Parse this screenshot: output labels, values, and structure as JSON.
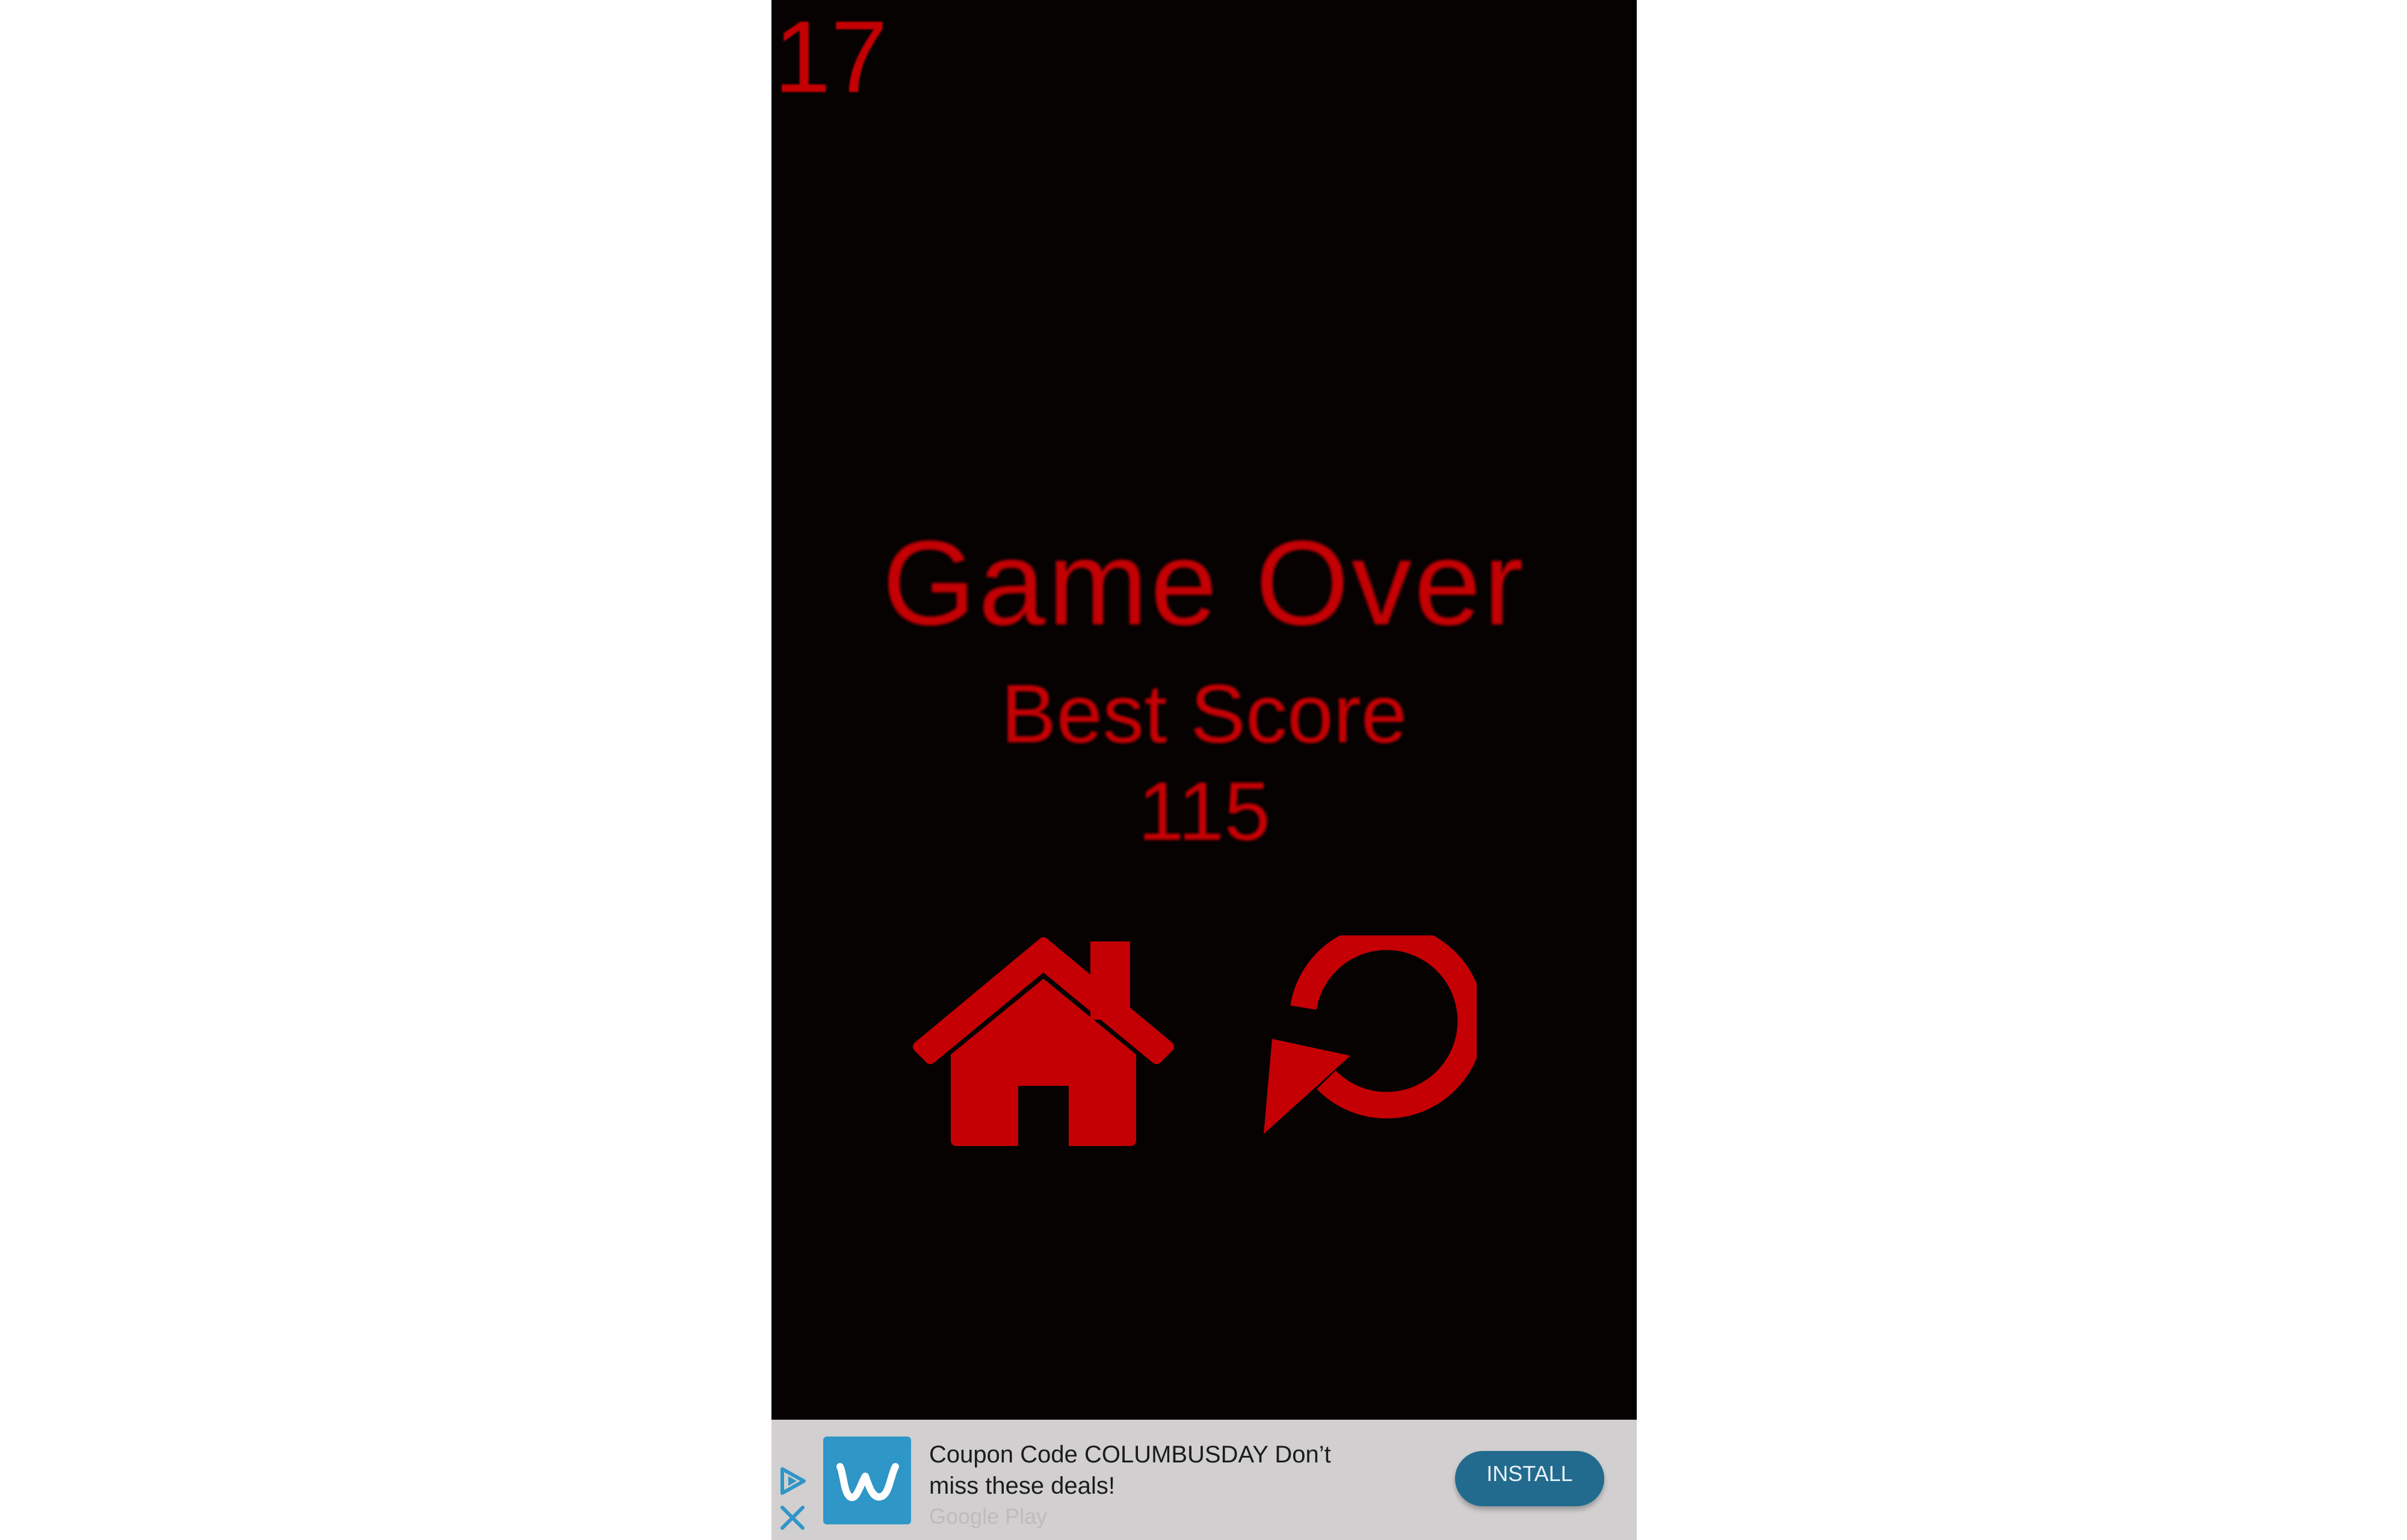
{
  "game": {
    "current_score": "17",
    "title": "Game Over",
    "best_score_label": "Best Score",
    "best_score_value": "115",
    "home_icon": "home-icon",
    "restart_icon": "restart-icon",
    "accent_color": "#c40004",
    "background_color": "#060202"
  },
  "ad": {
    "message": "Coupon Code COLUMBUSDAY Don’t miss these deals!",
    "install_label": "INSTALL",
    "footer_text": "Google Play",
    "logo_icon": "wish-logo-icon",
    "choices_icon": "adchoices-icon",
    "close_icon": "close-icon",
    "button_color": "#226b8f",
    "logo_color": "#2f96c8"
  }
}
